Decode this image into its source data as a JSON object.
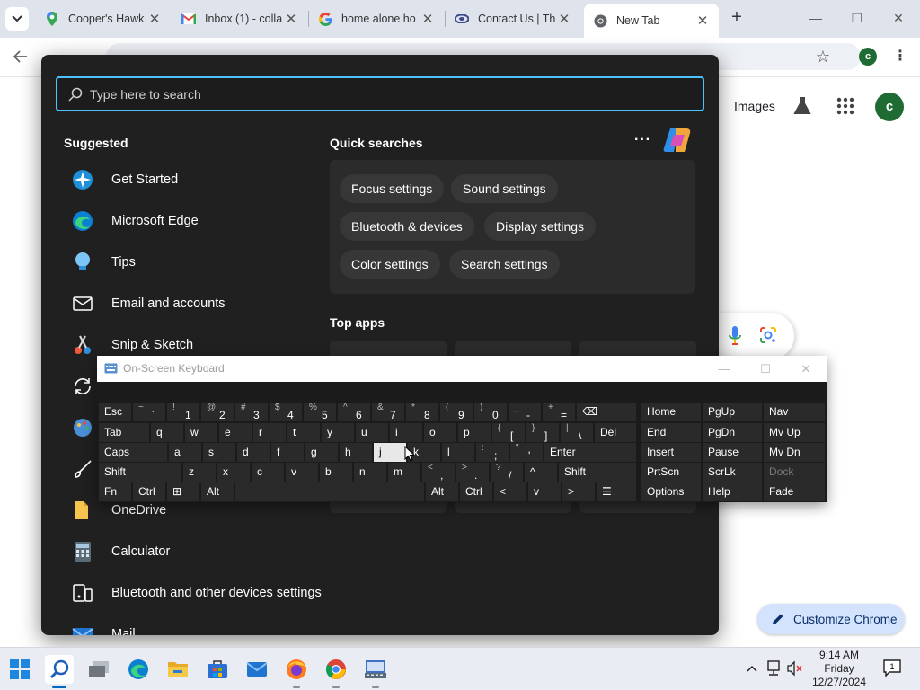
{
  "browser": {
    "tabs": [
      {
        "title": "Cooper's Hawk",
        "icon": "maps-pin-icon",
        "active": false
      },
      {
        "title": "Inbox (1) - colla",
        "icon": "gmail-icon",
        "active": false
      },
      {
        "title": "home alone ho",
        "icon": "google-g-icon",
        "active": false
      },
      {
        "title": "Contact Us | Th",
        "icon": "site-logo-icon",
        "active": false
      },
      {
        "title": "New Tab",
        "icon": "chrome-icon",
        "active": true
      }
    ],
    "tab_close_glyph": "✕",
    "new_tab_glyph": "+",
    "window_controls": {
      "minimize": "—",
      "maximize": "❐",
      "close": "✕"
    },
    "profile_initial": "c"
  },
  "ntp": {
    "images_link": "Images",
    "avatar_initial": "c",
    "customize_label": "Customize Chrome"
  },
  "start_panel": {
    "search_placeholder": "Type here to search",
    "suggested_heading": "Suggested",
    "suggested": [
      {
        "label": "Get Started",
        "icon": "get-started-icon"
      },
      {
        "label": "Microsoft Edge",
        "icon": "edge-icon"
      },
      {
        "label": "Tips",
        "icon": "tips-icon"
      },
      {
        "label": "Email and accounts",
        "icon": "mail-icon"
      },
      {
        "label": "Snip & Sketch",
        "icon": "snip-sketch-icon"
      },
      {
        "label": "",
        "icon": "sync-icon"
      },
      {
        "label": "",
        "icon": "paint-icon"
      },
      {
        "label": "",
        "icon": "brush-icon"
      },
      {
        "label": "OneDrive",
        "icon": "onedrive-icon"
      },
      {
        "label": "Calculator",
        "icon": "calculator-icon"
      },
      {
        "label": "Bluetooth and other devices settings",
        "icon": "bluetooth-devices-icon"
      },
      {
        "label": "Mail",
        "icon": "mail-app-icon"
      }
    ],
    "quick_heading": "Quick searches",
    "quick_more": "···",
    "quick_searches": [
      "Focus settings",
      "Sound settings",
      "Bluetooth & devices",
      "Display settings",
      "Color settings",
      "Search settings"
    ],
    "top_apps_heading": "Top apps"
  },
  "osk": {
    "title": "On-Screen Keyboard",
    "window_controls": {
      "minimize": "—",
      "maximize": "☐",
      "close": "✕"
    },
    "rows": [
      [
        {
          "label": "Esc"
        },
        {
          "top": "~",
          "bottom": "`"
        },
        {
          "top": "!",
          "bottom": "1"
        },
        {
          "top": "@",
          "bottom": "2"
        },
        {
          "top": "#",
          "bottom": "3"
        },
        {
          "top": "$",
          "bottom": "4"
        },
        {
          "top": "%",
          "bottom": "5"
        },
        {
          "top": "^",
          "bottom": "6"
        },
        {
          "top": "&",
          "bottom": "7"
        },
        {
          "top": "*",
          "bottom": "8"
        },
        {
          "top": "(",
          "bottom": "9"
        },
        {
          "top": ")",
          "bottom": "0"
        },
        {
          "top": "_",
          "bottom": "-"
        },
        {
          "top": "+",
          "bottom": "="
        },
        {
          "label": "⌫"
        }
      ],
      [
        {
          "label": "Tab"
        },
        {
          "label": "q"
        },
        {
          "label": "w"
        },
        {
          "label": "e"
        },
        {
          "label": "r"
        },
        {
          "label": "t"
        },
        {
          "label": "y"
        },
        {
          "label": "u"
        },
        {
          "label": "i"
        },
        {
          "label": "o"
        },
        {
          "label": "p"
        },
        {
          "top": "{",
          "bottom": "["
        },
        {
          "top": "}",
          "bottom": "]"
        },
        {
          "top": "|",
          "bottom": "\\"
        },
        {
          "label": "Del"
        }
      ],
      [
        {
          "label": "Caps"
        },
        {
          "label": "a"
        },
        {
          "label": "s"
        },
        {
          "label": "d"
        },
        {
          "label": "f"
        },
        {
          "label": "g"
        },
        {
          "label": "h"
        },
        {
          "label": "j"
        },
        {
          "label": "k"
        },
        {
          "label": "l"
        },
        {
          "top": ":",
          "bottom": ";"
        },
        {
          "top": "\"",
          "bottom": "'"
        },
        {
          "label": "Enter"
        }
      ],
      [
        {
          "label": "Shift"
        },
        {
          "label": "z"
        },
        {
          "label": "x"
        },
        {
          "label": "c"
        },
        {
          "label": "v"
        },
        {
          "label": "b"
        },
        {
          "label": "n"
        },
        {
          "label": "m"
        },
        {
          "top": "<",
          "bottom": ","
        },
        {
          "top": ">",
          "bottom": "."
        },
        {
          "top": "?",
          "bottom": "/"
        },
        {
          "label": "^"
        },
        {
          "label": "Shift"
        }
      ],
      [
        {
          "label": "Fn"
        },
        {
          "label": "Ctrl"
        },
        {
          "label": "⊞"
        },
        {
          "label": "Alt"
        },
        {
          "label": ""
        },
        {
          "label": "Alt"
        },
        {
          "label": "Ctrl"
        },
        {
          "label": "<"
        },
        {
          "label": "v"
        },
        {
          "label": ">"
        },
        {
          "label": "☰"
        }
      ]
    ],
    "nav_keys": [
      [
        "Home",
        "PgUp",
        "Nav"
      ],
      [
        "End",
        "PgDn",
        "Mv Up"
      ],
      [
        "Insert",
        "Pause",
        "Mv Dn"
      ],
      [
        "PrtScn",
        "ScrLk",
        "Dock"
      ],
      [
        "Options",
        "Help",
        "Fade"
      ]
    ],
    "highlighted_key": "j"
  },
  "taskbar": {
    "apps": [
      "windows-start-icon",
      "search-icon",
      "task-view-icon",
      "edge-icon",
      "file-explorer-icon",
      "microsoft-store-icon",
      "mail-icon",
      "firefox-icon",
      "chrome-icon",
      "on-screen-keyboard-icon"
    ],
    "time": "9:14 AM",
    "day": "Friday",
    "date": "12/27/2024",
    "notification_count": "1"
  }
}
